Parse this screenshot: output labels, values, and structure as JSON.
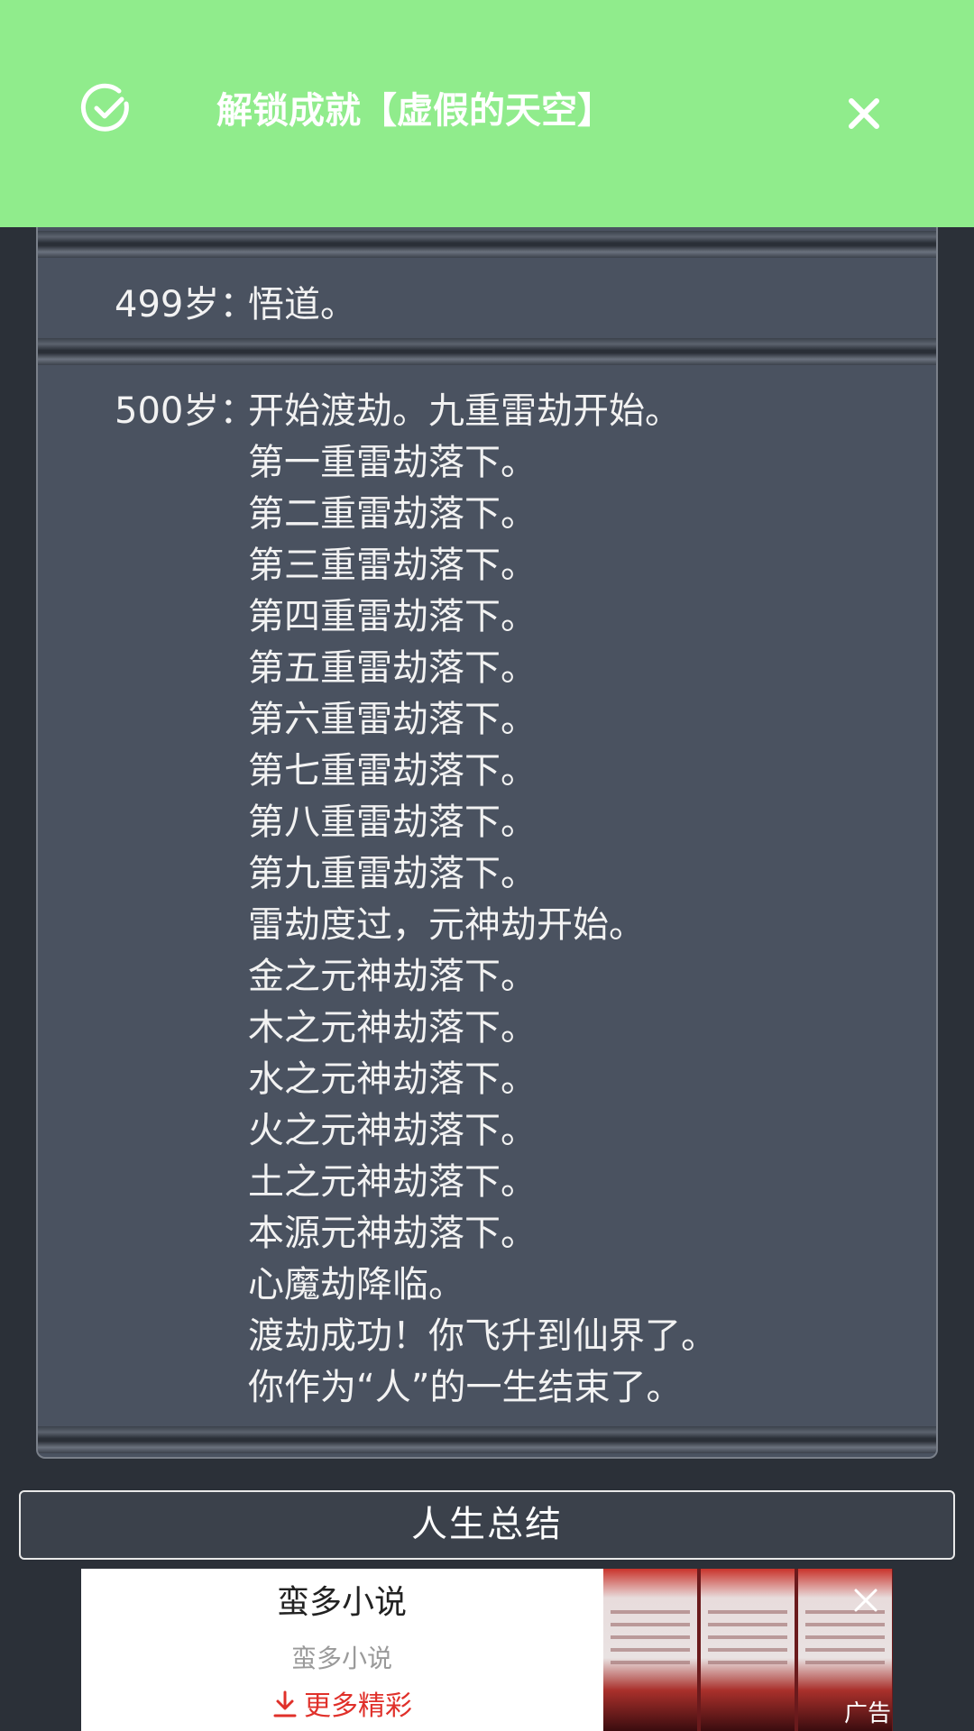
{
  "toast": {
    "icon": "check-circle-icon",
    "title": "解锁成就【虚假的天空】",
    "close_icon": "close-icon",
    "background": "#90ec8c"
  },
  "log": {
    "entries": [
      {
        "age": "499岁：",
        "lines": [
          "悟道。"
        ]
      },
      {
        "age": "500岁：",
        "lines": [
          "开始渡劫。九重雷劫开始。",
          "第一重雷劫落下。",
          "第二重雷劫落下。",
          "第三重雷劫落下。",
          "第四重雷劫落下。",
          "第五重雷劫落下。",
          "第六重雷劫落下。",
          "第七重雷劫落下。",
          "第八重雷劫落下。",
          "第九重雷劫落下。",
          "雷劫度过，元神劫开始。",
          "金之元神劫落下。",
          "木之元神劫落下。",
          "水之元神劫落下。",
          "火之元神劫落下。",
          "土之元神劫落下。",
          "本源元神劫落下。",
          "心魔劫降临。",
          "渡劫成功！你飞升到仙界了。",
          "你作为“人”的一生结束了。"
        ]
      }
    ]
  },
  "summary_button": {
    "label": "人生总结"
  },
  "ad": {
    "title": "蛮多小说",
    "subtitle": "蛮多小说",
    "more_label": "更多精彩",
    "more_icon": "download-icon",
    "close_icon": "close-icon",
    "ad_label": "广告",
    "accent": "#e0302a"
  }
}
